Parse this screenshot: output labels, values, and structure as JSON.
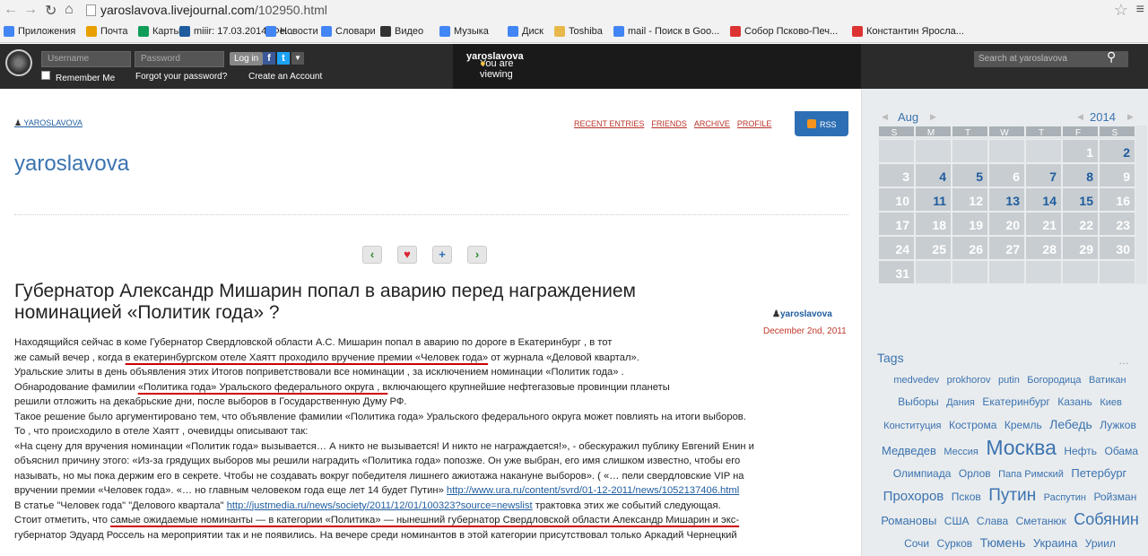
{
  "browser": {
    "url_host": "yaroslavova.livejournal.com",
    "url_path": "/102950.html",
    "bookmarks": [
      {
        "label": "Приложения",
        "icon": "apps-icon",
        "color": "#4285f4"
      },
      {
        "label": "Почта",
        "icon": "mail-icon",
        "color": "#e8a000"
      },
      {
        "label": "Карты",
        "icon": "maps-icon",
        "color": "#0f9d58"
      },
      {
        "label": "miiir: 17.03.2014. Фе...",
        "icon": "user-icon",
        "color": "#1e5c9e"
      },
      {
        "label": "Новости",
        "icon": "news-icon",
        "color": "#4285f4"
      },
      {
        "label": "Словари",
        "icon": "dict-icon",
        "color": "#4285f4"
      },
      {
        "label": "Видео",
        "icon": "video-icon",
        "color": "#333333"
      },
      {
        "label": "Музыка",
        "icon": "music-icon",
        "color": "#4285f4"
      },
      {
        "label": "Диск",
        "icon": "disk-icon",
        "color": "#4285f4"
      },
      {
        "label": "Toshiba",
        "icon": "folder-icon",
        "color": "#e8b84a"
      },
      {
        "label": "mail - Поиск в Goo...",
        "icon": "google-icon",
        "color": "#4285f4"
      },
      {
        "label": "Собор Псково-Печ...",
        "icon": "yandex-icon",
        "color": "#d33"
      },
      {
        "label": "Константин Яросла...",
        "icon": "yandex-icon",
        "color": "#d33"
      }
    ]
  },
  "ljbar": {
    "username_placeholder": "Username",
    "password_placeholder": "Password",
    "login_label": "Log in",
    "remember_label": "Remember Me",
    "forgot_label": "Forgot your password?",
    "create_label": "Create an Account",
    "viewing_prefix": "You are viewing",
    "viewing_user": "yaroslavova",
    "search_placeholder": "Search at yaroslavova"
  },
  "journal": {
    "user_small": "YAROSLAVOVA",
    "title": "yaroslavova",
    "nav": [
      "RECENT ENTRIES",
      "FRIENDS",
      "ARCHIVE",
      "PROFILE"
    ],
    "rss_label": "RSS"
  },
  "post": {
    "title": "Губернатор Александр Мишарин попал в аварию перед награждением номинацией «Политик года» ?",
    "author": "yaroslavova",
    "date": "December 2nd, 2011",
    "lines": [
      "Находящийся  сейчас в коме  Губернатор Свердловской области   А.С. Мишарин  попал  в  аварию   по дороге в  Екатеринбург ,     в тот",
      "же  самый вечер  ,  когда  в екатеринбургском отеле  Хаятт  проходило  вручение премии «Человек года» от журнала «Деловой квартал».",
      "Уральские элиты   в  день объявления  этих Итогов  поприветствовали   все  номинации , за исключением     номинации «Политик года» .",
      "        Обнародование  фамилии    «Политика года»  Уральского  федерального округа ,  включающего  крупнейшие  нефтегазовые  провинции  планеты",
      "решили отложить на декабрьские дни,  после выборов   в Государственную  Думу  РФ.",
      "Такое  решение было аргументировано тем, что   объявление  фамилии  «Политика  года»  Уральского федерального округа  может повлиять на итоги выборов.",
      "  То , что  происходило в отеле  Хаятт ,     очевидцы описывают  так:",
      "«На сцену для вручения номинации «Политик года» вызывается… А никто не вызывается! И никто не награждается!», - обескуражил публику Евгений Енин и",
      "объяснил причину этого: «Из-за грядущих выборов мы решили наградить «Политика года» попозже. Он уже выбран, его имя слишком известно, чтобы его",
      "называть, но мы пока держим его в секрете. Чтобы не создавать вокруг победителя лишнего ажиотажа накануне выборов». ( «… пели свердловские VIP на",
      "вручении премии «Человек года». «… но главным человеком года еще лет 14 будет Путин»",
      " В  статье  \"Человек года\" \"Делового квартала\"",
      "Стоит отметить, что самые ожидаемые номинанты — в категории «Политика» — нынешний губернатор Свердловской области Александр Мишарин и экс-",
      "губернатор Эдуард Россель на мероприятии так и не появились. На вечере среди номинантов в этой категории присутствовал только Аркадий Чернецкий"
    ],
    "link1": "http://www.ura.ru/content/svrd/01-12-2011/news/1052137406.html",
    "link2": "http://justmedia.ru/news/society/2011/12/01/100323?source=newslist",
    "line12_tail": " трактовка этих же    событий  следующая."
  },
  "calendar": {
    "month": "Aug",
    "year": "2014",
    "weekdays": [
      "S",
      "M",
      "T",
      "W",
      "T",
      "F",
      "S"
    ],
    "days": [
      "",
      "",
      "",
      "",
      "",
      "1",
      "2",
      "3",
      "4",
      "5",
      "6",
      "7",
      "8",
      "9",
      "10",
      "11",
      "12",
      "13",
      "14",
      "15",
      "16",
      "17",
      "18",
      "19",
      "20",
      "21",
      "22",
      "23",
      "24",
      "25",
      "26",
      "27",
      "28",
      "29",
      "30",
      "31",
      "",
      "",
      "",
      "",
      "",
      ""
    ],
    "linked_days": [
      "2",
      "4",
      "5",
      "7",
      "8",
      "11",
      "13",
      "14",
      "15"
    ]
  },
  "tags": {
    "title": "Tags",
    "more": "…",
    "items": [
      {
        "t": "medvedev",
        "s": 11
      },
      {
        "t": "prokhorov",
        "s": 11
      },
      {
        "t": "putin",
        "s": 11
      },
      {
        "t": "Богородица",
        "s": 11
      },
      {
        "t": "Ватикан",
        "s": 11
      },
      {
        "t": "Выборы",
        "s": 12
      },
      {
        "t": "Дания",
        "s": 11
      },
      {
        "t": "Екатеринбург",
        "s": 12
      },
      {
        "t": "Казань",
        "s": 12
      },
      {
        "t": "Киев",
        "s": 11
      },
      {
        "t": "Конституция",
        "s": 11
      },
      {
        "t": "Кострома",
        "s": 12
      },
      {
        "t": "Кремль",
        "s": 12
      },
      {
        "t": "Лебедь",
        "s": 14
      },
      {
        "t": "Лужков",
        "s": 12
      },
      {
        "t": "Медведев",
        "s": 13
      },
      {
        "t": "Мессия",
        "s": 11
      },
      {
        "t": "Москва",
        "s": 23
      },
      {
        "t": "Нефть",
        "s": 12
      },
      {
        "t": "Обама",
        "s": 12
      },
      {
        "t": "Олимпиада",
        "s": 12
      },
      {
        "t": "Орлов",
        "s": 12
      },
      {
        "t": "Папа Римский",
        "s": 11
      },
      {
        "t": "Петербург",
        "s": 13
      },
      {
        "t": "Прохоров",
        "s": 15
      },
      {
        "t": "Псков",
        "s": 12
      },
      {
        "t": "Путин",
        "s": 19
      },
      {
        "t": "Распутин",
        "s": 11
      },
      {
        "t": "Ройзман",
        "s": 12
      },
      {
        "t": "Романовы",
        "s": 13
      },
      {
        "t": "США",
        "s": 12
      },
      {
        "t": "Слава",
        "s": 12
      },
      {
        "t": "Сметанюк",
        "s": 12
      },
      {
        "t": "Собянин",
        "s": 18
      },
      {
        "t": "Сочи",
        "s": 12
      },
      {
        "t": "Сурков",
        "s": 12
      },
      {
        "t": "Тюмень",
        "s": 14
      },
      {
        "t": "Украина",
        "s": 13
      },
      {
        "t": "Уриил",
        "s": 12
      }
    ]
  }
}
